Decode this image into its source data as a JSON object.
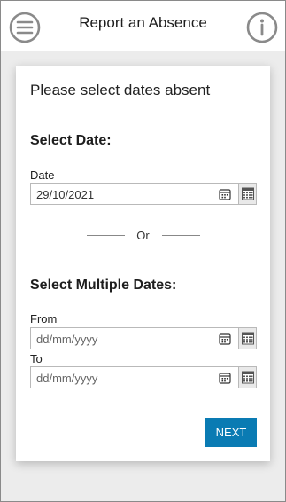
{
  "header": {
    "title": "Report an Absence",
    "menu_icon": "hamburger-menu-icon",
    "info_icon": "info-icon"
  },
  "card": {
    "title": "Please select dates absent",
    "single": {
      "section_title": "Select Date:",
      "label": "Date",
      "value": "29/10/2021"
    },
    "divider_text": "Or",
    "multiple": {
      "section_title": "Select Multiple Dates:",
      "from_label": "From",
      "from_placeholder": "dd/mm/yyyy",
      "to_label": "To",
      "to_placeholder": "dd/mm/yyyy"
    },
    "next_label": "NEXT"
  },
  "colors": {
    "accent": "#0a7bb3",
    "background": "#ececec",
    "icon_grey": "#8a8a8a"
  }
}
